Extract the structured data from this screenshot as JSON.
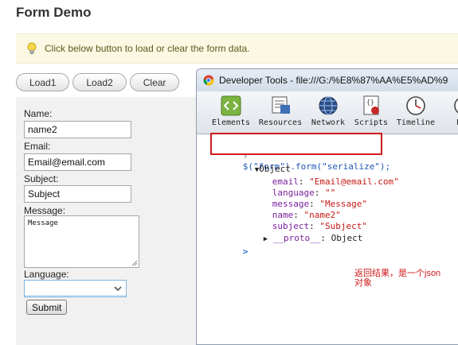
{
  "page": {
    "title": "Form Demo"
  },
  "info": {
    "text": "Click below button to load or clear the form data.",
    "icon": "lightbulb-icon"
  },
  "buttons": {
    "load1": "Load1",
    "load2": "Load2",
    "clear": "Clear"
  },
  "form": {
    "name_label": "Name:",
    "name_value": "name2",
    "email_label": "Email:",
    "email_value": "Email@email.com",
    "subject_label": "Subject:",
    "subject_value": "Subject",
    "message_label": "Message:",
    "message_value": "Message",
    "language_label": "Language:",
    "language_value": "",
    "submit_label": "Submit"
  },
  "devtools": {
    "window_title": "Developer Tools - file:///G:/%E8%87%AA%E5%AD%9",
    "tabs": [
      {
        "label": "Elements",
        "icon": "elements-icon"
      },
      {
        "label": "Resources",
        "icon": "resources-icon"
      },
      {
        "label": "Network",
        "icon": "network-icon"
      },
      {
        "label": "Scripts",
        "icon": "scripts-icon"
      },
      {
        "label": "Timeline",
        "icon": "timeline-icon"
      },
      {
        "label": "Pro",
        "icon": "profiles-icon"
      }
    ],
    "console": {
      "command": "$(\"form\").form(\"serialize\");",
      "object_label": "Object",
      "props": [
        {
          "key": "email",
          "value": "\"Email@email.com\""
        },
        {
          "key": "language",
          "value": "\"\""
        },
        {
          "key": "message",
          "value": "\"Message\""
        },
        {
          "key": "name",
          "value": "\"name2\""
        },
        {
          "key": "subject",
          "value": "\"Subject\""
        }
      ],
      "proto_key": "__proto__",
      "proto_value": "Object",
      "prompt": ">"
    },
    "annotation_line1": "返回结果，是一个json",
    "annotation_line2": "对象"
  },
  "colors": {
    "highlight_box": "#d11a1a",
    "command_text": "#1c57b6",
    "property_key": "#7a1f9c",
    "string_value": "#c41a16"
  }
}
